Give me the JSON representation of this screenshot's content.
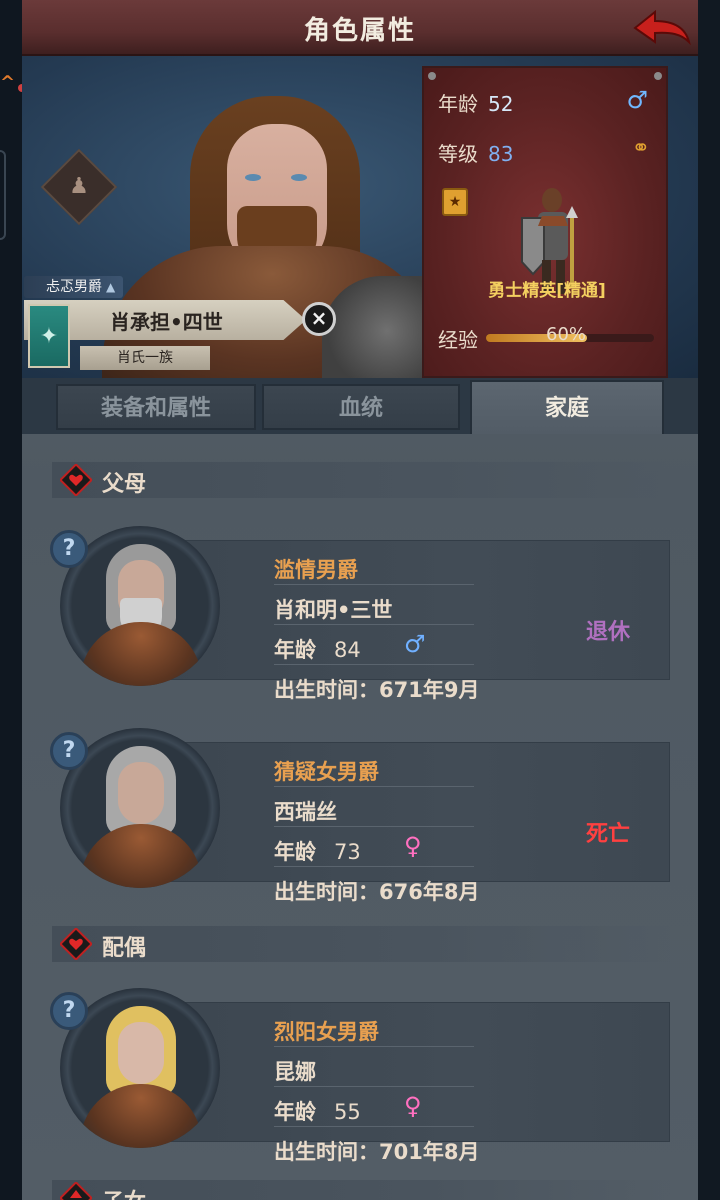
{
  "header": {
    "title": "角色属性"
  },
  "character": {
    "title": "忐忑男爵",
    "name": "肖承担•四世",
    "family": "肖氏一族"
  },
  "stats": {
    "age_label": "年龄",
    "age": "52",
    "level_label": "等级",
    "level": "83",
    "unit_name": "勇士精英[精通]",
    "exp_label": "经验",
    "exp_percent_text": "60%",
    "exp_fraction": 0.6
  },
  "tabs": [
    {
      "label": "装备和属性"
    },
    {
      "label": "血统"
    },
    {
      "label": "家庭"
    }
  ],
  "sections": {
    "parents": "父母",
    "spouse": "配偶",
    "children": "子女"
  },
  "parents": [
    {
      "title": "滥情男爵",
      "name": "肖和明•三世",
      "age_label": "年龄",
      "age": "84",
      "gender": "male",
      "birth": "出生时间：671年9月",
      "status": "退休"
    },
    {
      "title": "猜疑女男爵",
      "name": "西瑞丝",
      "age_label": "年龄",
      "age": "73",
      "gender": "female",
      "birth": "出生时间：676年8月",
      "status": "死亡"
    }
  ],
  "spouse": [
    {
      "title": "烈阳女男爵",
      "name": "昆娜",
      "age_label": "年龄",
      "age": "55",
      "gender": "female",
      "birth": "出生时间：701年8月",
      "status": ""
    }
  ],
  "colors": {
    "accent_title": "#e8a050",
    "retired": "#b070c0",
    "dead": "#ff4040"
  }
}
